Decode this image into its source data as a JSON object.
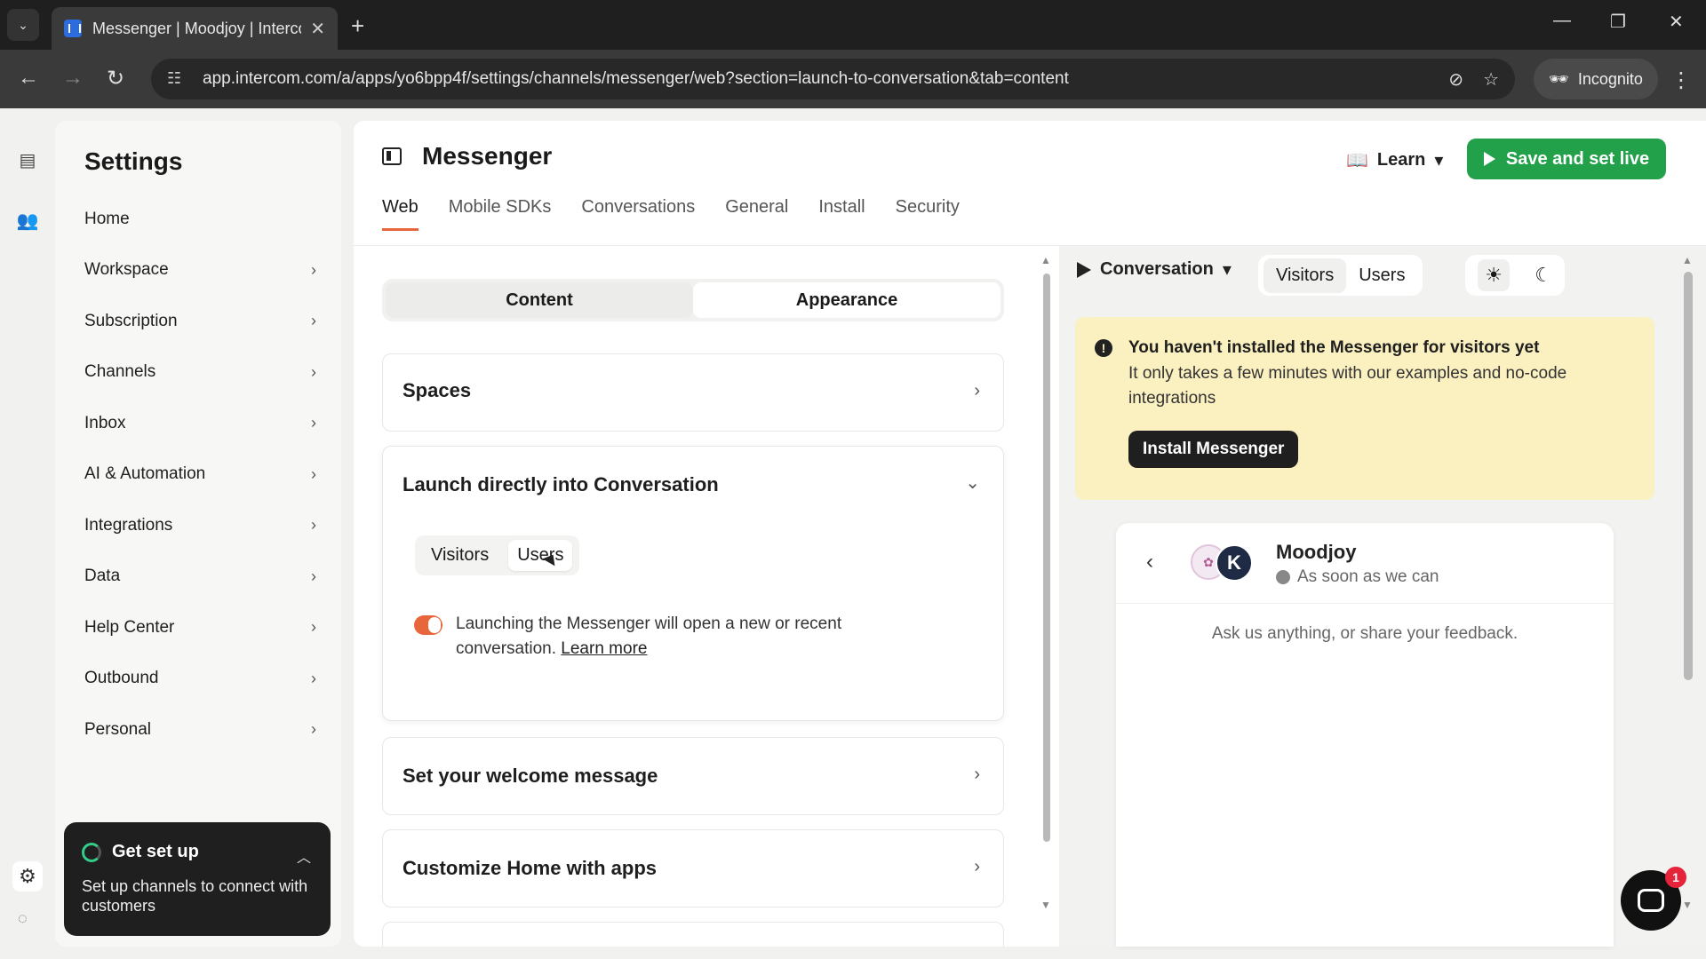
{
  "browser": {
    "tab_title": "Messenger | Moodjoy | Intercom",
    "url": "app.intercom.com/a/apps/yo6bpp4f/settings/channels/messenger/web?section=launch-to-conversation&tab=content",
    "incognito_label": "Incognito"
  },
  "settings": {
    "title": "Settings",
    "nav": [
      {
        "label": "Home",
        "has_chevron": false
      },
      {
        "label": "Workspace",
        "has_chevron": true
      },
      {
        "label": "Subscription",
        "has_chevron": true
      },
      {
        "label": "Channels",
        "has_chevron": true
      },
      {
        "label": "Inbox",
        "has_chevron": true
      },
      {
        "label": "AI & Automation",
        "has_chevron": true
      },
      {
        "label": "Integrations",
        "has_chevron": true
      },
      {
        "label": "Data",
        "has_chevron": true
      },
      {
        "label": "Help Center",
        "has_chevron": true
      },
      {
        "label": "Outbound",
        "has_chevron": true
      },
      {
        "label": "Personal",
        "has_chevron": true
      }
    ],
    "get_set_up": {
      "title": "Get set up",
      "subtitle": "Set up channels to connect with customers"
    }
  },
  "main": {
    "title": "Messenger",
    "learn_label": "Learn",
    "save_label": "Save and set live",
    "tabs": [
      "Web",
      "Mobile SDKs",
      "Conversations",
      "General",
      "Install",
      "Security"
    ],
    "active_tab": "Web",
    "content_tabs": [
      "Content",
      "Appearance"
    ],
    "active_content_tab": "Content",
    "sections": {
      "spaces": "Spaces",
      "launch": {
        "title": "Launch directly into Conversation",
        "audience": [
          "Visitors",
          "Users"
        ],
        "active_audience": "Users",
        "toggle_on": true,
        "toggle_text": "Launching the Messenger will open a new or recent conversation.",
        "learn_more": "Learn more"
      },
      "welcome": "Set your welcome message",
      "customize_home": "Customize Home with apps"
    }
  },
  "preview": {
    "mode_label": "Conversation",
    "audience": [
      "Visitors",
      "Users"
    ],
    "active_audience": "Visitors",
    "warning": {
      "title": "You haven't installed the Messenger for visitors yet",
      "body": "It only takes a few minutes with our examples and no-code integrations",
      "button": "Install Messenger"
    },
    "messenger": {
      "avatar_letter": "K",
      "name": "Moodjoy",
      "status": "As soon as we can",
      "prompt": "Ask us anything, or share your feedback."
    },
    "launcher_badge": "1"
  },
  "colors": {
    "accent_orange": "#e8663c",
    "save_green": "#22a04a",
    "warning_bg": "#fbf0c0"
  }
}
